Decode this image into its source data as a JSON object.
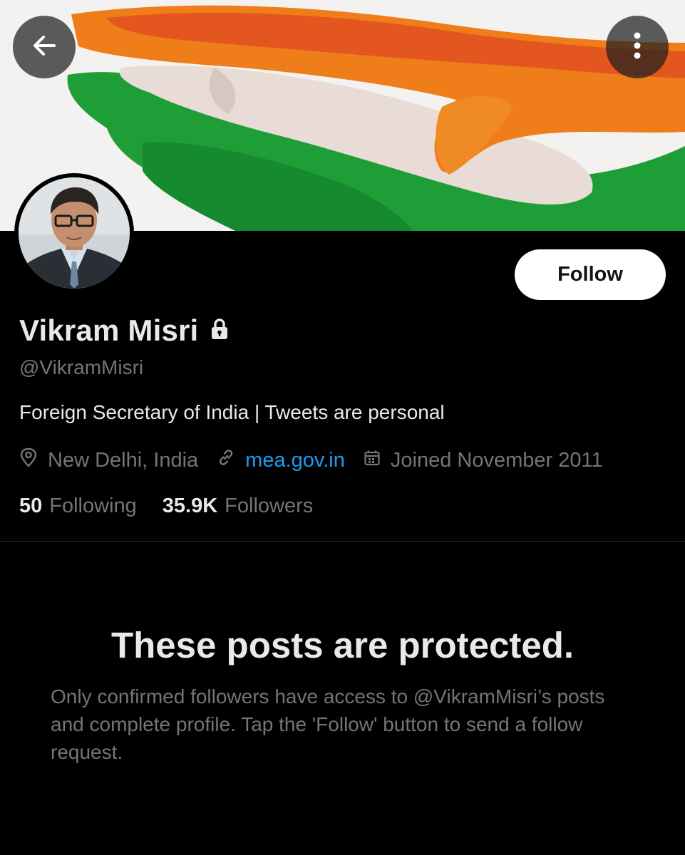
{
  "profile": {
    "display_name": "Vikram Misri",
    "handle": "@VikramMisri",
    "bio": "Foreign Secretary of India | Tweets are personal",
    "location": "New Delhi, India",
    "website": "mea.gov.in",
    "joined": "Joined November 2011",
    "protected": true
  },
  "actions": {
    "follow_label": "Follow"
  },
  "stats": {
    "following_count": "50",
    "following_label": "Following",
    "followers_count": "35.9K",
    "followers_label": "Followers"
  },
  "protected_notice": {
    "title": "These posts are protected.",
    "body": "Only confirmed followers have access to @VikramMisri’s posts and complete profile. Tap the 'Follow' button to send a follow request."
  },
  "icons": {
    "back": "arrow-left-icon",
    "more": "more-vertical-icon",
    "lock": "lock-icon",
    "location": "location-pin-icon",
    "link": "link-icon",
    "calendar": "calendar-icon"
  },
  "colors": {
    "background": "#000000",
    "text_primary": "#e7e9ea",
    "text_secondary": "#71767b",
    "link": "#1d9bf0",
    "divider": "#2f3336",
    "button_bg": "#ffffff",
    "button_text": "#0f1419"
  }
}
